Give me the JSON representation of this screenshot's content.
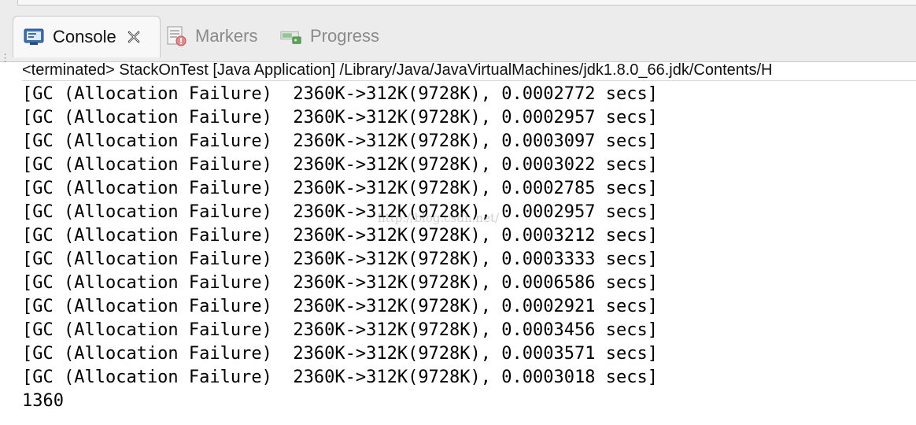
{
  "tabs": {
    "console": "Console",
    "markers": "Markers",
    "progress": "Progress"
  },
  "status": "<terminated> StackOnTest [Java Application] /Library/Java/JavaVirtualMachines/jdk1.8.0_66.jdk/Contents/H",
  "output": {
    "lines": [
      "[GC (Allocation Failure)  2360K->312K(9728K), 0.0002772 secs]",
      "[GC (Allocation Failure)  2360K->312K(9728K), 0.0002957 secs]",
      "[GC (Allocation Failure)  2360K->312K(9728K), 0.0003097 secs]",
      "[GC (Allocation Failure)  2360K->312K(9728K), 0.0003022 secs]",
      "[GC (Allocation Failure)  2360K->312K(9728K), 0.0002785 secs]",
      "[GC (Allocation Failure)  2360K->312K(9728K), 0.0002957 secs]",
      "[GC (Allocation Failure)  2360K->312K(9728K), 0.0003212 secs]",
      "[GC (Allocation Failure)  2360K->312K(9728K), 0.0003333 secs]",
      "[GC (Allocation Failure)  2360K->312K(9728K), 0.0006586 secs]",
      "[GC (Allocation Failure)  2360K->312K(9728K), 0.0002921 secs]",
      "[GC (Allocation Failure)  2360K->312K(9728K), 0.0003456 secs]",
      "[GC (Allocation Failure)  2360K->312K(9728K), 0.0003571 secs]",
      "[GC (Allocation Failure)  2360K->312K(9728K), 0.0003018 secs]",
      "1360"
    ]
  },
  "watermark": "http://blog.csdn.net/",
  "icons": {
    "console": "console-icon",
    "close": "close-icon",
    "markers": "markers-icon",
    "progress": "progress-icon"
  }
}
